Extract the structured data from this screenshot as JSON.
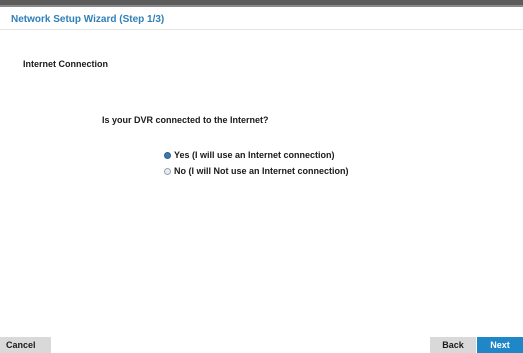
{
  "window": {
    "title": "Network Setup Wizard (Step 1/3)"
  },
  "section": {
    "heading": "Internet Connection"
  },
  "question": {
    "text": "Is your DVR connected to the Internet?"
  },
  "options": [
    {
      "label": "Yes (I will use an Internet connection)",
      "selected": true
    },
    {
      "label": "No (I will Not use an Internet connection)",
      "selected": false
    }
  ],
  "footer": {
    "cancel_label": "Cancel",
    "back_label": "Back",
    "next_label": "Next"
  },
  "colors": {
    "title": "#2f7fb8",
    "primary_button": "#1f86c8",
    "radio_selected": "#3f77ad"
  }
}
